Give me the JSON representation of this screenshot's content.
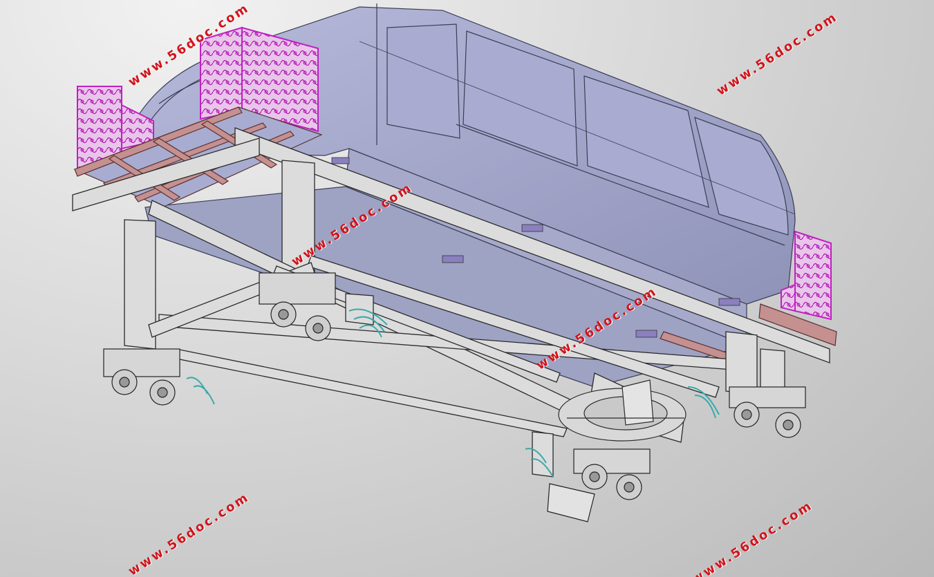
{
  "watermarks": [
    "www.56doc.com",
    "www.56doc.com",
    "www.56doc.com",
    "www.56doc.com",
    "www.56doc.com",
    "www.56doc.com"
  ],
  "colors": {
    "background": "#c9c9c9",
    "cabin_body": "#9fa3c4",
    "frame_steel": "#d9d9d9",
    "railing": "#c020c0",
    "deck_beam": "#c49090",
    "hydraulic": "#40b0b0",
    "watermark": "#d1141b"
  }
}
